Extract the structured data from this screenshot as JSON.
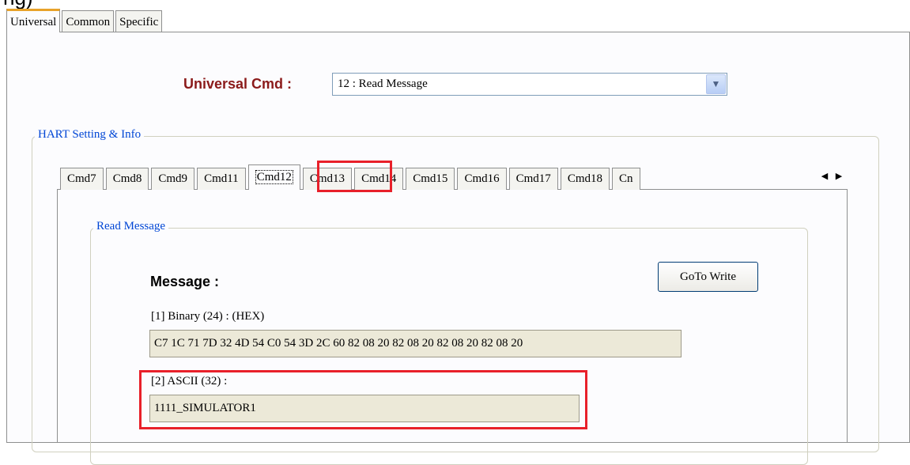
{
  "top_fragment": "ng)",
  "outer_tabs": [
    {
      "label": "Universal",
      "active": true
    },
    {
      "label": "Common",
      "active": false
    },
    {
      "label": "Specific",
      "active": false
    }
  ],
  "universal_cmd": {
    "label": "Universal Cmd :",
    "selected": "12 : Read Message"
  },
  "hart_group": {
    "legend": "HART Setting & Info"
  },
  "inner_tabs": [
    {
      "label": "Cmd7"
    },
    {
      "label": "Cmd8"
    },
    {
      "label": "Cmd9"
    },
    {
      "label": "Cmd11"
    },
    {
      "label": "Cmd12",
      "active": true
    },
    {
      "label": "Cmd13"
    },
    {
      "label": "Cmd14"
    },
    {
      "label": "Cmd15"
    },
    {
      "label": "Cmd16"
    },
    {
      "label": "Cmd17"
    },
    {
      "label": "Cmd18"
    },
    {
      "label": "Cn"
    }
  ],
  "read_message": {
    "legend": "Read Message",
    "goto_button": "GoTo Write",
    "message_label": "Message :",
    "binary_label": "[1] Binary (24) : (HEX)",
    "binary_value": "C7 1C 71 7D 32 4D 54 C0 54 3D 2C 60 82 08 20 82 08 20 82 08 20 82 08 20",
    "ascii_label": "[2] ASCII (32) :",
    "ascii_value": "1111_SIMULATOR1"
  },
  "colors": {
    "label_red": "#8b1a1a",
    "legend_blue": "#0046d5",
    "highlight": "#e8202a",
    "active_tab_accent": "#e8a22a"
  }
}
